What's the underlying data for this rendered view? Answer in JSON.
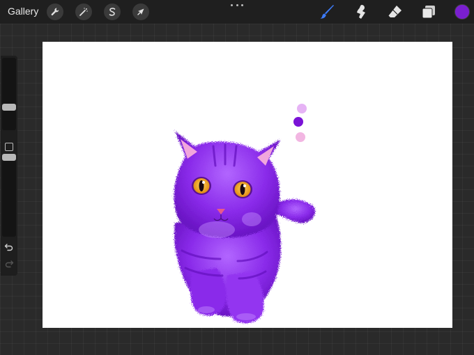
{
  "topbar": {
    "gallery_label": "Gallery",
    "left_tools": [
      "wrench-icon",
      "magic-wand-icon",
      "selection-s-icon",
      "arrow-cursor-icon"
    ],
    "right_tools": [
      "brush-icon",
      "smudge-icon",
      "eraser-icon",
      "layers-icon"
    ],
    "active_tool": "brush-icon",
    "active_tool_color": "#3d7bf7",
    "current_color": "#7a1fd0"
  },
  "sidebar": {
    "brush_size_level": 0.3,
    "opacity_level": 0.55,
    "icons": [
      "modify-square-icon",
      "undo-icon",
      "redo-icon"
    ]
  },
  "canvas": {
    "background": "#ffffff",
    "swatches": [
      "#e6b3f5",
      "#7a12d6",
      "#f2b6e2"
    ],
    "cat_fur_color": "#8a2bea",
    "cat_eye_color": "#f0a21e"
  }
}
